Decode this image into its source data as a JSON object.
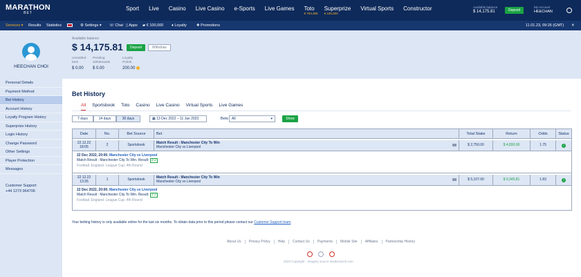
{
  "brand": {
    "name": "MARATHON",
    "sub": "BET"
  },
  "main_nav": [
    {
      "label": "Sport",
      "count": ""
    },
    {
      "label": "Live",
      "count": ""
    },
    {
      "label": "Casino",
      "count": ""
    },
    {
      "label": "Live Casino",
      "count": ""
    },
    {
      "label": "e-Sports",
      "count": ""
    },
    {
      "label": "Live Games",
      "count": ""
    },
    {
      "label": "Toto",
      "count": "€ 763,365"
    },
    {
      "label": "Superprize",
      "count": "€ 100,000"
    },
    {
      "label": "Virtual Sports",
      "count": ""
    },
    {
      "label": "Constructor",
      "count": ""
    }
  ],
  "header": {
    "balance_label": "Available balance",
    "balance_value": "$ 14,175.81",
    "deposit_label": "Deposit",
    "account_label": "My Account",
    "account_name": "HEECHAN"
  },
  "subbar": {
    "services": "Services",
    "results": "Results",
    "statistics": "Statistics",
    "settings": "Settings",
    "chat": "Chat",
    "apps": "Apps",
    "jackpot": "€ 100,000",
    "loyalty": "Loyalty",
    "promotions": "Promotions",
    "datetime": "11.01.23, 09:26 (GMT)"
  },
  "sidebar": {
    "user_name": "HEECHAN CHOI",
    "items": [
      {
        "label": "Personal Details"
      },
      {
        "label": "Payment Method"
      },
      {
        "label": "Bet History"
      },
      {
        "label": "Account History"
      },
      {
        "label": "Loyalty Program History"
      },
      {
        "label": "Superprize History"
      },
      {
        "label": "Login History"
      },
      {
        "label": "Change Password"
      },
      {
        "label": "Other Settings"
      },
      {
        "label": "Player Protection"
      },
      {
        "label": "Messages"
      }
    ],
    "active_index": 2,
    "support_label": "Customer Support",
    "support_phone": "+44 1273 964706"
  },
  "balance": {
    "label": "Available balance",
    "amount": "$ 14,175.81",
    "deposit": "Deposit",
    "withdraw": "Withdraw",
    "unsettled_label_1": "Unsettled",
    "unsettled_label_2": "bets",
    "unsettled_value": "$ 0.00",
    "pending_label_1": "Pending",
    "pending_label_2": "withdrawals",
    "pending_value": "$ 0.00",
    "loyalty_label_1": "Loyalty",
    "loyalty_label_2": "Points",
    "loyalty_value": "200.00"
  },
  "page": {
    "title": "Bet History"
  },
  "tabs": [
    {
      "label": "All"
    },
    {
      "label": "Sportsbook"
    },
    {
      "label": "Toto"
    },
    {
      "label": "Casino"
    },
    {
      "label": "Live Casino"
    },
    {
      "label": "Virtual Sports"
    },
    {
      "label": "Live Games"
    }
  ],
  "filters": {
    "period_buttons": [
      "7 days",
      "14 days",
      "30 days"
    ],
    "active_period": 2,
    "date_range": "13 Dec 2022 – 11 Jan 2023",
    "bets_label": "Bets",
    "bets_value": "All",
    "show_label": "Show"
  },
  "table": {
    "columns": [
      "Date",
      "No.",
      "Bet Source",
      "Bet",
      "Total Stake",
      "Return",
      "Odds",
      "Status"
    ],
    "rows": [
      {
        "date1": "22.12.22",
        "date2": "18:05",
        "no": "2",
        "source": "Sportsbook",
        "bet_title": "Match Result - Manchester City To Win",
        "bet_match": "Manchester City vs Liverpool",
        "stake": "$ 2,750.00",
        "return": "$ 4,830.00",
        "odds": "1.75",
        "detail_date": "22 Dec 2022, 20:00.",
        "detail_match": "Manchester City vs Liverpool",
        "detail_result": "Match Result : Manchester City To Win. Result:",
        "detail_score": "3:2",
        "detail_league": "Football. England. League Cup. 4th Round"
      },
      {
        "date1": "22.12.22",
        "date2": "13:35",
        "no": "1",
        "source": "Sportsbook",
        "bet_title": "Match Result - Manchester City To Win",
        "bet_match": "Manchester City vs Liverpool",
        "stake": "$ 5,107.00",
        "return": "$ 9,345.81",
        "odds": "1.83",
        "detail_date": "22 Dec 2022, 20:00.",
        "detail_match": "Manchester City vs Liverpool",
        "detail_result": "Match Result : Manchester City To Win. Result:",
        "detail_score": "3:2",
        "detail_league": "Football. England. League Cup. 4th Round"
      }
    ]
  },
  "notes": {
    "history_text": "Your betting history is only available online for the last six months. To obtain data prior to this period please contact our",
    "history_link": "Customer Support team",
    "history_end": "."
  },
  "footer": {
    "links": [
      "About Us",
      "Privacy Policy",
      "Help",
      "Contact Us",
      "Payments",
      "Mobile Site",
      "Affiliates",
      "Partnership History"
    ],
    "copyright": "2023 Copyright · Imagery source shutterstock.com"
  },
  "colors": {
    "navy": "#0e2a5a",
    "green": "#1ba345",
    "accent": "#f3b128",
    "red": "#d0312d"
  }
}
